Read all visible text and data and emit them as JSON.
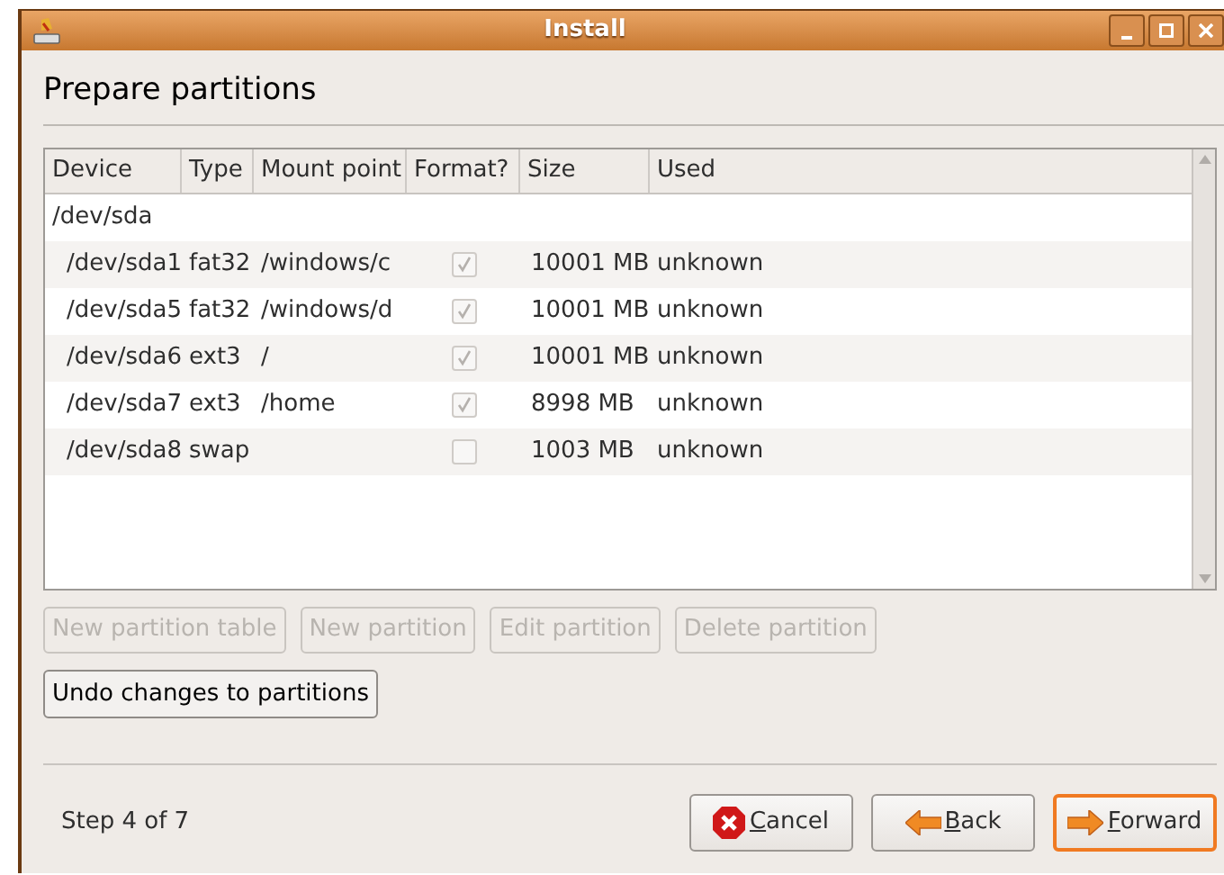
{
  "window": {
    "title": "Install"
  },
  "heading": "Prepare partitions",
  "table": {
    "columns": [
      "Device",
      "Type",
      "Mount point",
      "Format?",
      "Size",
      "Used"
    ],
    "disk": "/dev/sda",
    "rows": [
      {
        "device": "/dev/sda1",
        "type": "fat32",
        "mount": "/windows/c",
        "format": true,
        "size": "10001 MB",
        "used": "unknown"
      },
      {
        "device": "/dev/sda5",
        "type": "fat32",
        "mount": "/windows/d",
        "format": true,
        "size": "10001 MB",
        "used": "unknown"
      },
      {
        "device": "/dev/sda6",
        "type": "ext3",
        "mount": "/",
        "format": true,
        "size": "10001 MB",
        "used": "unknown"
      },
      {
        "device": "/dev/sda7",
        "type": "ext3",
        "mount": "/home",
        "format": true,
        "size": "8998 MB",
        "used": "unknown"
      },
      {
        "device": "/dev/sda8",
        "type": "swap",
        "mount": "",
        "format": false,
        "size": "1003 MB",
        "used": "unknown"
      }
    ]
  },
  "partition_buttons": [
    {
      "label": "New partition table",
      "disabled": true
    },
    {
      "label": "New partition",
      "disabled": true
    },
    {
      "label": "Edit partition",
      "disabled": true
    },
    {
      "label": "Delete partition",
      "disabled": true
    }
  ],
  "undo_button": {
    "label": "Undo changes to partitions",
    "disabled": false
  },
  "step": "Step 4 of 7",
  "nav_buttons": [
    {
      "kind": "cancel",
      "label": "Cancel",
      "underlined": true,
      "focused": false
    },
    {
      "kind": "back",
      "label": "Back",
      "underlined": true,
      "focused": false
    },
    {
      "kind": "forward",
      "label": "Forward",
      "underlined": true,
      "focused": true
    }
  ]
}
